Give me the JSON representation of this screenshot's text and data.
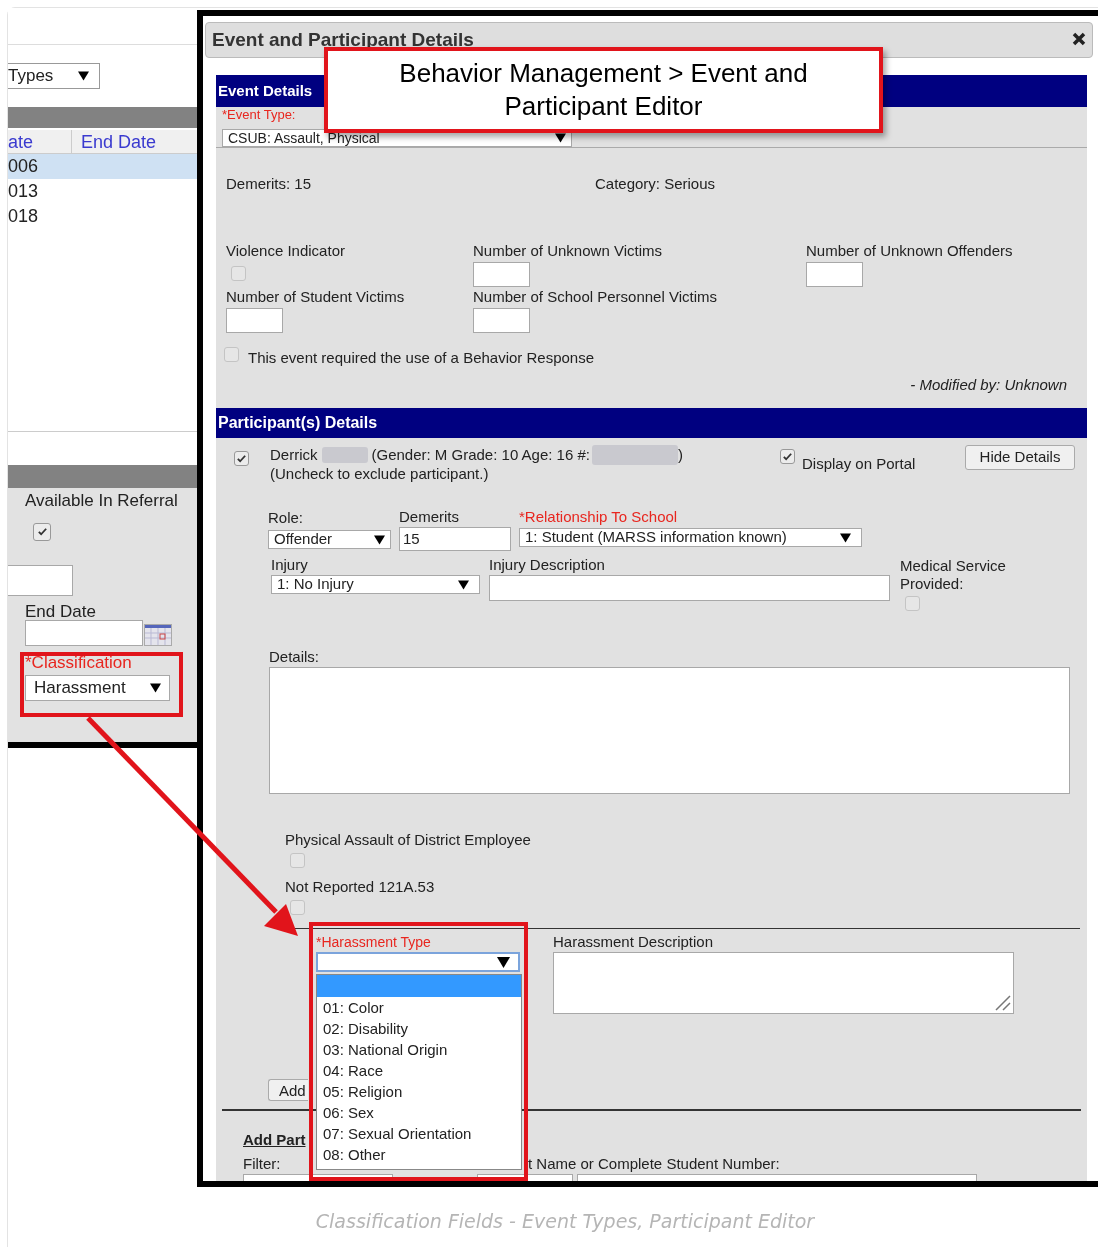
{
  "background_page": {
    "type_filter": "Types",
    "columns": [
      "ate",
      "End Date"
    ],
    "rows": [
      {
        "start": "006",
        "selected": true
      },
      {
        "start": "013",
        "selected": false
      },
      {
        "start": "018",
        "selected": false
      }
    ],
    "available_in_referral": {
      "label": "Available In Referral",
      "checked": true
    },
    "end_date": {
      "label": "End Date"
    },
    "classification": {
      "label": "*Classification",
      "required": true,
      "value": "Harassment"
    }
  },
  "callout": {
    "lines": [
      "Behavior Management > Event and",
      "Participant Editor"
    ]
  },
  "dialog": {
    "title": "Event and Participant Details",
    "event_details": {
      "heading": "Event Details",
      "event_type": {
        "label": "*Event Type:",
        "required": true,
        "value": "CSUB: Assault, Physical"
      },
      "demerits": "Demerits: 15",
      "category": "Category: Serious",
      "fields": [
        {
          "kind": "checkbox",
          "label": "Violence Indicator",
          "checked": false
        },
        {
          "kind": "input",
          "label": "Number of Unknown Victims"
        },
        {
          "kind": "input",
          "label": "Number of Unknown Offenders"
        },
        {
          "kind": "input",
          "label": "Number of Student Victims"
        },
        {
          "kind": "input",
          "label": "Number of School Personnel Victims"
        }
      ],
      "behavior_response": {
        "label": "This event required the use of a Behavior Response",
        "checked": false
      },
      "modified_by": "- Modified by: Unknown"
    },
    "participants": {
      "heading": "Participant(s) Details",
      "included": true,
      "first_name": "Derrick",
      "info": "(Gender: M Grade: 10 Age: 16 #:",
      "info_end": ")",
      "note": "(Uncheck to exclude participant.)",
      "display_on_portal": {
        "label": "Display on Portal",
        "checked": true
      },
      "hide_details_button": "Hide Details",
      "role": {
        "label": "Role:",
        "value": "Offender"
      },
      "demerits": {
        "label": "Demerits",
        "value": "15"
      },
      "relationship": {
        "label": "*Relationship To School",
        "required": true,
        "value": "1: Student (MARSS information known)"
      },
      "injury": {
        "label": "Injury",
        "value": "1: No Injury"
      },
      "injury_description": {
        "label": "Injury Description"
      },
      "medical_service": {
        "label": "Medical Service Provided:",
        "checked": false
      },
      "details": {
        "label": "Details:"
      },
      "physical_assault": {
        "label": "Physical Assault of District Employee",
        "checked": false
      },
      "not_reported": {
        "label": "Not Reported 121A.53",
        "checked": false
      },
      "harassment_type": {
        "label": "*Harassment Type",
        "required": true,
        "expanded": true,
        "blank_option_highlighted": true,
        "options": [
          {
            "label": "01: Color",
            "selected": false
          },
          {
            "label": "02: Disability",
            "selected": false
          },
          {
            "label": "03: National Origin",
            "selected": false
          },
          {
            "label": "04: Race",
            "selected": false
          },
          {
            "label": "05: Religion",
            "selected": false
          },
          {
            "label": "06: Sex",
            "selected": false
          },
          {
            "label": "07: Sexual Orientation",
            "selected": false
          },
          {
            "label": "08: Other",
            "selected": false
          }
        ]
      },
      "harassment_description": {
        "label": "Harassment Description"
      },
      "add_button": "Add"
    },
    "add_participant": {
      "heading": "Add Part",
      "filter_label": "Filter:",
      "search_label": "t Name or Complete Student Number:"
    }
  },
  "caption": "Classification Fields - Event Types, Participant Editor"
}
